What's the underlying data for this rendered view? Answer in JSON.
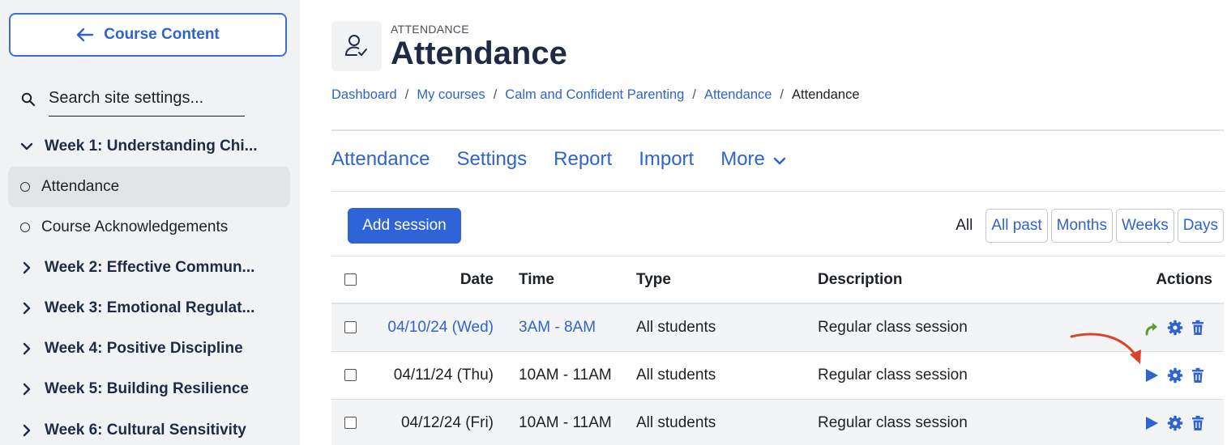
{
  "sidebar": {
    "back_label": "Course Content",
    "search_placeholder": "Search site settings...",
    "items": [
      {
        "label": "Week 1: Understanding Chi...",
        "kind": "section",
        "expanded": true
      },
      {
        "label": "Attendance",
        "kind": "activity",
        "active": true
      },
      {
        "label": "Course Acknowledgements",
        "kind": "activity"
      },
      {
        "label": "Week 2: Effective Commun...",
        "kind": "section"
      },
      {
        "label": "Week 3: Emotional Regulat...",
        "kind": "section"
      },
      {
        "label": "Week 4: Positive Discipline",
        "kind": "section"
      },
      {
        "label": "Week 5: Building Resilience",
        "kind": "section"
      },
      {
        "label": "Week 6: Cultural Sensitivity",
        "kind": "section"
      }
    ]
  },
  "header": {
    "kicker": "ATTENDANCE",
    "title": "Attendance",
    "icon": "user-check-icon"
  },
  "breadcrumb": [
    "Dashboard",
    "My courses",
    "Calm and Confident Parenting",
    "Attendance",
    "Attendance"
  ],
  "tabs": [
    "Attendance",
    "Settings",
    "Report",
    "Import",
    "More"
  ],
  "toolbar": {
    "add_session": "Add session",
    "filters": {
      "all": "All",
      "all_past": "All past",
      "months": "Months",
      "weeks": "Weeks",
      "days": "Days"
    }
  },
  "table": {
    "headers": {
      "date": "Date",
      "time": "Time",
      "type": "Type",
      "description": "Description",
      "actions": "Actions"
    },
    "rows": [
      {
        "date": "04/10/24 (Wed)",
        "time": "3AM - 8AM",
        "type": "All students",
        "description": "Regular class session",
        "primary_action": "change-attendance-icon",
        "linked": true
      },
      {
        "date": "04/11/24 (Thu)",
        "time": "10AM - 11AM",
        "type": "All students",
        "description": "Regular class session",
        "primary_action": "take-attendance-icon",
        "linked": false
      },
      {
        "date": "04/12/24 (Fri)",
        "time": "10AM - 11AM",
        "type": "All students",
        "description": "Regular class session",
        "primary_action": "take-attendance-icon",
        "linked": false
      }
    ]
  },
  "colors": {
    "accent": "#2f63cf",
    "primary_button": "#2f63d8",
    "title": "#1f2a44",
    "annotation_arrow": "#d9452b",
    "refresh_green": "#5aa02c"
  }
}
